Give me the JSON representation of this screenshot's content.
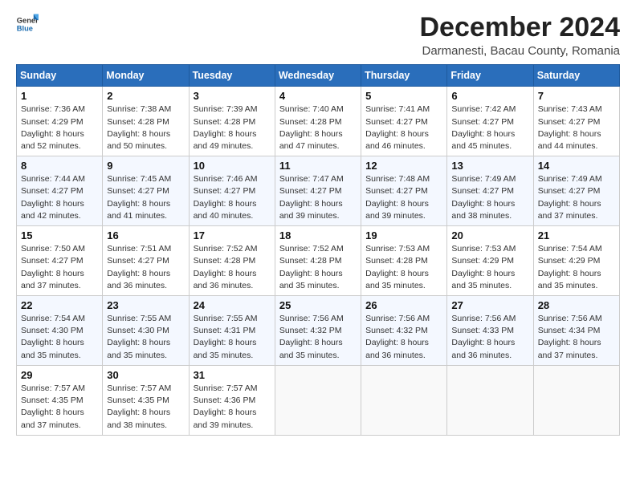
{
  "header": {
    "logo_line1": "General",
    "logo_line2": "Blue",
    "main_title": "December 2024",
    "sub_title": "Darmanesti, Bacau County, Romania"
  },
  "weekdays": [
    "Sunday",
    "Monday",
    "Tuesday",
    "Wednesday",
    "Thursday",
    "Friday",
    "Saturday"
  ],
  "weeks": [
    [
      {
        "day": "1",
        "sunrise": "7:36 AM",
        "sunset": "4:29 PM",
        "daylight": "8 hours and 52 minutes."
      },
      {
        "day": "2",
        "sunrise": "7:38 AM",
        "sunset": "4:28 PM",
        "daylight": "8 hours and 50 minutes."
      },
      {
        "day": "3",
        "sunrise": "7:39 AM",
        "sunset": "4:28 PM",
        "daylight": "8 hours and 49 minutes."
      },
      {
        "day": "4",
        "sunrise": "7:40 AM",
        "sunset": "4:28 PM",
        "daylight": "8 hours and 47 minutes."
      },
      {
        "day": "5",
        "sunrise": "7:41 AM",
        "sunset": "4:27 PM",
        "daylight": "8 hours and 46 minutes."
      },
      {
        "day": "6",
        "sunrise": "7:42 AM",
        "sunset": "4:27 PM",
        "daylight": "8 hours and 45 minutes."
      },
      {
        "day": "7",
        "sunrise": "7:43 AM",
        "sunset": "4:27 PM",
        "daylight": "8 hours and 44 minutes."
      }
    ],
    [
      {
        "day": "8",
        "sunrise": "7:44 AM",
        "sunset": "4:27 PM",
        "daylight": "8 hours and 42 minutes."
      },
      {
        "day": "9",
        "sunrise": "7:45 AM",
        "sunset": "4:27 PM",
        "daylight": "8 hours and 41 minutes."
      },
      {
        "day": "10",
        "sunrise": "7:46 AM",
        "sunset": "4:27 PM",
        "daylight": "8 hours and 40 minutes."
      },
      {
        "day": "11",
        "sunrise": "7:47 AM",
        "sunset": "4:27 PM",
        "daylight": "8 hours and 39 minutes."
      },
      {
        "day": "12",
        "sunrise": "7:48 AM",
        "sunset": "4:27 PM",
        "daylight": "8 hours and 39 minutes."
      },
      {
        "day": "13",
        "sunrise": "7:49 AM",
        "sunset": "4:27 PM",
        "daylight": "8 hours and 38 minutes."
      },
      {
        "day": "14",
        "sunrise": "7:49 AM",
        "sunset": "4:27 PM",
        "daylight": "8 hours and 37 minutes."
      }
    ],
    [
      {
        "day": "15",
        "sunrise": "7:50 AM",
        "sunset": "4:27 PM",
        "daylight": "8 hours and 37 minutes."
      },
      {
        "day": "16",
        "sunrise": "7:51 AM",
        "sunset": "4:27 PM",
        "daylight": "8 hours and 36 minutes."
      },
      {
        "day": "17",
        "sunrise": "7:52 AM",
        "sunset": "4:28 PM",
        "daylight": "8 hours and 36 minutes."
      },
      {
        "day": "18",
        "sunrise": "7:52 AM",
        "sunset": "4:28 PM",
        "daylight": "8 hours and 35 minutes."
      },
      {
        "day": "19",
        "sunrise": "7:53 AM",
        "sunset": "4:28 PM",
        "daylight": "8 hours and 35 minutes."
      },
      {
        "day": "20",
        "sunrise": "7:53 AM",
        "sunset": "4:29 PM",
        "daylight": "8 hours and 35 minutes."
      },
      {
        "day": "21",
        "sunrise": "7:54 AM",
        "sunset": "4:29 PM",
        "daylight": "8 hours and 35 minutes."
      }
    ],
    [
      {
        "day": "22",
        "sunrise": "7:54 AM",
        "sunset": "4:30 PM",
        "daylight": "8 hours and 35 minutes."
      },
      {
        "day": "23",
        "sunrise": "7:55 AM",
        "sunset": "4:30 PM",
        "daylight": "8 hours and 35 minutes."
      },
      {
        "day": "24",
        "sunrise": "7:55 AM",
        "sunset": "4:31 PM",
        "daylight": "8 hours and 35 minutes."
      },
      {
        "day": "25",
        "sunrise": "7:56 AM",
        "sunset": "4:32 PM",
        "daylight": "8 hours and 35 minutes."
      },
      {
        "day": "26",
        "sunrise": "7:56 AM",
        "sunset": "4:32 PM",
        "daylight": "8 hours and 36 minutes."
      },
      {
        "day": "27",
        "sunrise": "7:56 AM",
        "sunset": "4:33 PM",
        "daylight": "8 hours and 36 minutes."
      },
      {
        "day": "28",
        "sunrise": "7:56 AM",
        "sunset": "4:34 PM",
        "daylight": "8 hours and 37 minutes."
      }
    ],
    [
      {
        "day": "29",
        "sunrise": "7:57 AM",
        "sunset": "4:35 PM",
        "daylight": "8 hours and 37 minutes."
      },
      {
        "day": "30",
        "sunrise": "7:57 AM",
        "sunset": "4:35 PM",
        "daylight": "8 hours and 38 minutes."
      },
      {
        "day": "31",
        "sunrise": "7:57 AM",
        "sunset": "4:36 PM",
        "daylight": "8 hours and 39 minutes."
      },
      null,
      null,
      null,
      null
    ]
  ],
  "labels": {
    "sunrise": "Sunrise:",
    "sunset": "Sunset:",
    "daylight": "Daylight:"
  }
}
